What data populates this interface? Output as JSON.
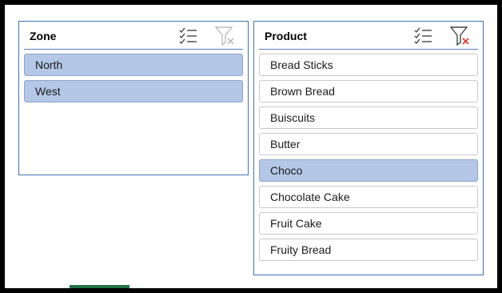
{
  "zone_slicer": {
    "title": "Zone",
    "items": [
      {
        "label": "North",
        "selected": true
      },
      {
        "label": "West",
        "selected": true
      }
    ]
  },
  "product_slicer": {
    "title": "Product",
    "items": [
      {
        "label": "Bread Sticks",
        "selected": false
      },
      {
        "label": "Brown Bread",
        "selected": false
      },
      {
        "label": "Buiscuits",
        "selected": false
      },
      {
        "label": "Butter",
        "selected": false
      },
      {
        "label": "Choco",
        "selected": true
      },
      {
        "label": "Chocolate Cake",
        "selected": false
      },
      {
        "label": "Fruit Cake",
        "selected": false
      },
      {
        "label": "Fruity Bread",
        "selected": false
      }
    ]
  },
  "icons": {
    "multi_select": "multi-select-icon",
    "clear_filter": "clear-filter-icon"
  },
  "colors": {
    "selected_fill": "#b4c7e7",
    "border_accent": "#3f6fb5",
    "clear_filter_active": "#e53935",
    "clear_filter_inactive": "#bdbdbd",
    "excel_green": "#217346"
  }
}
